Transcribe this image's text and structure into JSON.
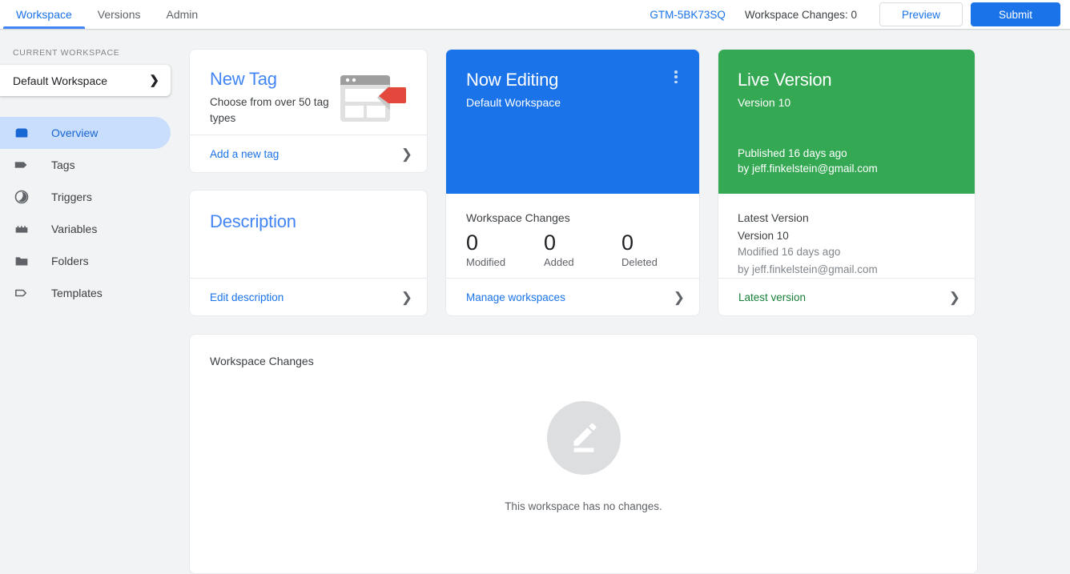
{
  "topbar": {
    "tabs": [
      {
        "label": "Workspace",
        "active": true
      },
      {
        "label": "Versions",
        "active": false
      },
      {
        "label": "Admin",
        "active": false
      }
    ],
    "container_id": "GTM-5BK73SQ",
    "workspace_changes_label": "Workspace Changes: 0",
    "preview_button": "Preview",
    "submit_button": "Submit"
  },
  "sidebar": {
    "section_label": "CURRENT WORKSPACE",
    "workspace_name": "Default Workspace",
    "items": [
      {
        "label": "Overview",
        "icon": "workspace-icon"
      },
      {
        "label": "Tags",
        "icon": "tag-icon"
      },
      {
        "label": "Triggers",
        "icon": "trigger-icon"
      },
      {
        "label": "Variables",
        "icon": "variables-icon"
      },
      {
        "label": "Folders",
        "icon": "folder-icon"
      },
      {
        "label": "Templates",
        "icon": "template-icon"
      }
    ]
  },
  "new_tag_card": {
    "title": "New Tag",
    "subtitle": "Choose from over 50 tag types",
    "footer_link": "Add a new tag",
    "illustration": "browser-window-with-tag-icon"
  },
  "description_card": {
    "title": "Description",
    "footer_link": "Edit description"
  },
  "now_editing_card": {
    "title": "Now Editing",
    "subtitle": "Default Workspace",
    "menu_icon": "kebab-menu-icon",
    "changes_title": "Workspace Changes",
    "counters": [
      {
        "value": "0",
        "label": "Modified"
      },
      {
        "value": "0",
        "label": "Added"
      },
      {
        "value": "0",
        "label": "Deleted"
      }
    ],
    "footer_link": "Manage workspaces"
  },
  "live_version_card": {
    "title": "Live Version",
    "version": "Version 10",
    "published_line1": "Published 16 days ago",
    "published_line2": "by jeff.finkelstein@gmail.com",
    "latest_title": "Latest Version",
    "latest_version": "Version 10",
    "latest_modified": "Modified 16 days ago",
    "latest_author": "by jeff.finkelstein@gmail.com",
    "footer_link": "Latest version"
  },
  "workspace_changes_panel": {
    "title": "Workspace Changes",
    "empty_icon": "edit-pencil-icon",
    "empty_text": "This workspace has no changes."
  },
  "colors": {
    "accent_blue": "#1a73e8",
    "live_green": "#34a853",
    "page_background": "#f1f3f4",
    "tag_red": "#e4483c"
  }
}
